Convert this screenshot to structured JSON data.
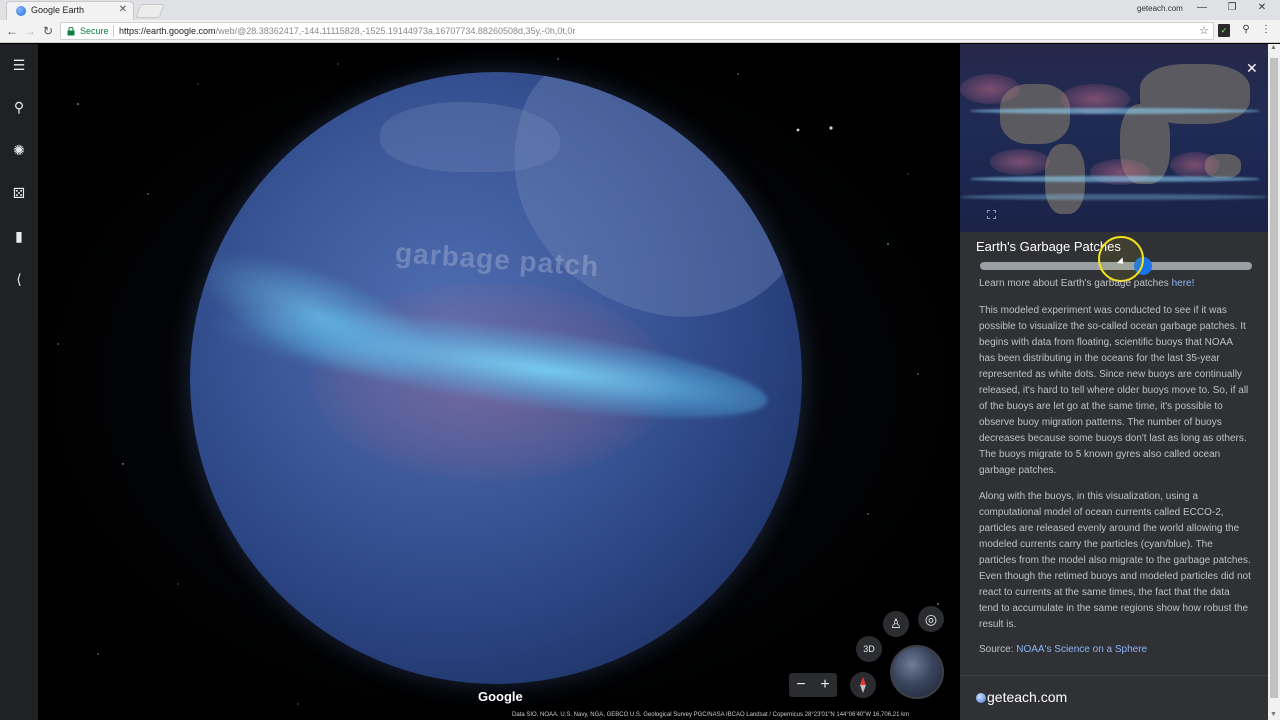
{
  "browser": {
    "tab_title": "Google Earth",
    "tab_close": "✕",
    "user_label": "geteach.com",
    "window_controls": [
      "—",
      "❐",
      "✕"
    ],
    "nav": {
      "back": "←",
      "forward": "→",
      "reload": "↻"
    },
    "secure_label": "Secure",
    "url_host": "https://earth.google.com",
    "url_path": "/web/@28.38362417,-144.11115828,-1525.19144973a,16707734.88260508d,35y,-0h,0t,0r",
    "star": "☆",
    "ext_icons": [
      "tiny-extension-icon",
      "maps-pin-icon",
      "kebab-menu-icon"
    ],
    "ext_kebab": "⋮",
    "ext_pin": "⚲"
  },
  "rail": {
    "items": [
      {
        "name": "menu-icon",
        "glyph": "☰"
      },
      {
        "name": "search-icon",
        "glyph": "⚲"
      },
      {
        "name": "voyager-icon",
        "glyph": "✺"
      },
      {
        "name": "feeling-lucky-dice-icon",
        "glyph": "⚄"
      },
      {
        "name": "projects-bookmark-icon",
        "glyph": "▮"
      },
      {
        "name": "share-icon",
        "glyph": "⟨"
      }
    ]
  },
  "globe": {
    "overlay_label": "garbage patch"
  },
  "map": {
    "google_logo": "Google",
    "attribution": "Data SIO, NOAA, U.S. Navy, NGA, GEBCO   U.S. Geological Survey   PGC/NASA   IBCAO   Landsat / Copernicus      28°23'01\"N 144°06'40\"W      16,706.21 km",
    "ctrl_3d": "3D",
    "zoom_out": "−",
    "zoom_in": "+",
    "pegman": "♙",
    "locate": "◎"
  },
  "panel": {
    "close": "✕",
    "title": "Earth's Garbage Patches",
    "slider_value_fraction": 0.6,
    "learn_prefix": "Learn more about Earth's garbage patches ",
    "learn_link": "here!",
    "paragraph1": "This modeled experiment was conducted to see if it was possible to visualize the so-called ocean garbage patches. It begins with data from floating, scientific buoys that NOAA has been distributing in the oceans for the last 35-year represented as white dots. Since new buoys are continually released, it's hard to tell where older buoys move to. So, if all of the buoys are let go at the same time, it's possible to observe buoy migration patterns. The number of buoys decreases because some buoys don't last as long as others. The buoys migrate to 5 known gyres also called ocean garbage patches.",
    "paragraph2": "Along with the buoys, in this visualization, using a computational model of ocean currents called ECCO-2, particles are released evenly around the world allowing the modeled currents carry the particles (cyan/blue). The particles from the model also migrate to the garbage patches. Even though the retimed buoys and modeled particles did not react to currents at the same times, the fact that the data tend to accumulate in the same regions show how robust the result is.",
    "source_prefix": "Source: ",
    "source_link": "NOAA's Science on a Sphere",
    "watermark": "geteach.com"
  },
  "scrollbar": {
    "up": "▲",
    "down": "▼"
  },
  "colors": {
    "accent_blue": "#1a73e8",
    "link_blue": "#8ab4f8",
    "panel_bg": "#303134",
    "rail_bg": "#202124",
    "cursor_highlight": "#f2e21a"
  }
}
